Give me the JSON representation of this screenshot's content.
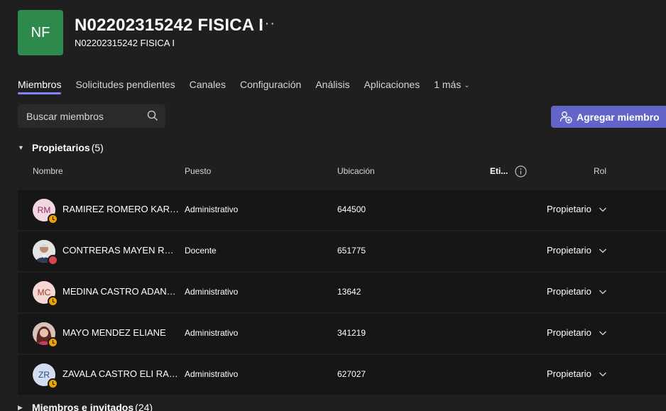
{
  "team": {
    "initials": "NF",
    "title": "N02202315242 FISICA I",
    "subtitle": "N02202315242 FISICA I",
    "more": "···",
    "avatar_color": "#2e8a4c"
  },
  "tabs": [
    {
      "label": "Miembros",
      "active": true
    },
    {
      "label": "Solicitudes pendientes"
    },
    {
      "label": "Canales"
    },
    {
      "label": "Configuración"
    },
    {
      "label": "Análisis"
    },
    {
      "label": "Aplicaciones"
    },
    {
      "label": "1 más"
    }
  ],
  "search": {
    "placeholder": "Buscar miembros"
  },
  "add_member": {
    "label": "Agregar miembro",
    "color": "#6264c7"
  },
  "owners_section": {
    "name": "Propietarios",
    "count": "(5)"
  },
  "members_section": {
    "name": "Miembros e invitados",
    "count": "(24)"
  },
  "columns": {
    "name": "Nombre",
    "position": "Puesto",
    "location": "Ubicación",
    "tags": "Eti...",
    "role": "Rol"
  },
  "owners": [
    {
      "initials": "RM",
      "name": "RAMIREZ ROMERO KARINA",
      "position": "Administrativo",
      "location": "644500",
      "role": "Propietario",
      "status": "away",
      "avatar_bg": "#f3d6e4",
      "avatar_fg": "#8b2e5c"
    },
    {
      "initials": "",
      "name": "CONTRERAS MAYEN RAUL",
      "position": "Docente",
      "location": "651775",
      "role": "Propietario",
      "status": "busy",
      "avatar_bg": "#cfcfcf",
      "avatar_fg": "#333333"
    },
    {
      "initials": "MC",
      "name": "MEDINA CASTRO ADANELY",
      "position": "Administrativo",
      "location": "13642",
      "role": "Propietario",
      "status": "away",
      "avatar_bg": "#f5d7d3",
      "avatar_fg": "#9a3a2e"
    },
    {
      "initials": "",
      "name": "MAYO MENDEZ ELIANE",
      "position": "Administrativo",
      "location": "341219",
      "role": "Propietario",
      "status": "away",
      "avatar_bg": "#caa59a",
      "avatar_fg": "#5a2a20"
    },
    {
      "initials": "ZR",
      "name": "ZAVALA CASTRO ELI RAMON",
      "position": "Administrativo",
      "location": "627027",
      "role": "Propietario",
      "status": "away",
      "avatar_bg": "#d3dcf0",
      "avatar_fg": "#2f4a82"
    }
  ]
}
